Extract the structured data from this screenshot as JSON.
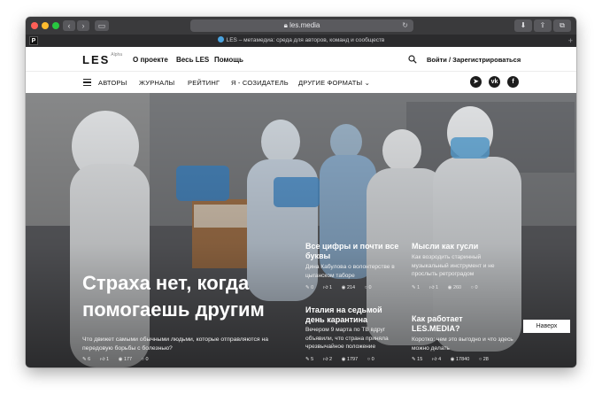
{
  "browser": {
    "url": "les.media",
    "tab_title": "LES – метамедиа: среда для авторов, команд и сообществ",
    "pinned_tab": "P"
  },
  "header": {
    "logo": "LES",
    "logo_badge": "Alpha",
    "links": [
      "О проекте",
      "Весь LES",
      "Помощь"
    ],
    "login": "Войти / Зарегистрироваться"
  },
  "nav": {
    "items": [
      "АВТОРЫ",
      "ЖУРНАЛЫ",
      "РЕЙТИНГ",
      "Я - СОЗИДАТЕЛЬ",
      "ДРУГИЕ ФОРМАТЫ"
    ],
    "social": [
      "telegram-icon",
      "vk-icon",
      "facebook-icon"
    ]
  },
  "hero": {
    "title": "Страха нет, когда помогаешь другим",
    "description": "Что движет самыми обычными людьми, которые отправляются на передовую борьбы с болезнью?",
    "stats": [
      "6",
      "1",
      "177",
      "0"
    ]
  },
  "cards": [
    {
      "title": "Все цифры и почти все буквы",
      "description": "Дина Кабулова о волонтерстве в цыганском таборе",
      "stats": [
        "0",
        "1",
        "214",
        "0"
      ]
    },
    {
      "title": "Мысли как гусли",
      "description": "Как возродить старинный музыкальный инструмент и не прослыть ретроградом",
      "stats": [
        "1",
        "1",
        "260",
        "0"
      ]
    },
    {
      "title": "Италия на седьмой день карантина",
      "description": "Вечером 9 марта по ТВ вдруг объявили, что страна приняла чрезвычайное положение",
      "stats": [
        "5",
        "2",
        "1797",
        "0"
      ]
    },
    {
      "title": "Как работает LES.MEDIA?",
      "description": "Коротко: чем это выгодно и что здесь можно делать",
      "stats": [
        "15",
        "4",
        "17840",
        "28"
      ]
    }
  ],
  "back_to_top": "Наверх",
  "colors": {
    "accent": "#111111",
    "chrome": "#3a3a3c"
  }
}
